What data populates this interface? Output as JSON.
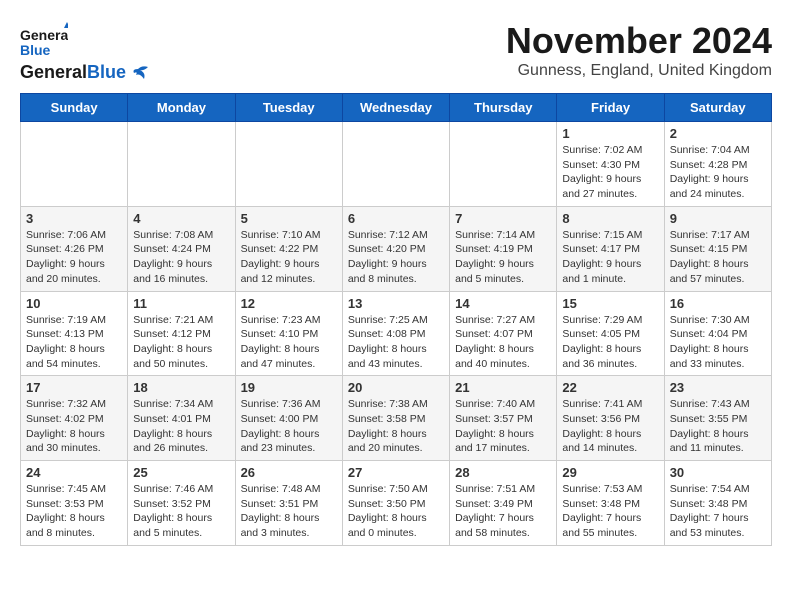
{
  "header": {
    "logo_general": "General",
    "logo_blue": "Blue",
    "month_year": "November 2024",
    "location": "Gunness, England, United Kingdom"
  },
  "days_of_week": [
    "Sunday",
    "Monday",
    "Tuesday",
    "Wednesday",
    "Thursday",
    "Friday",
    "Saturday"
  ],
  "weeks": [
    [
      {
        "day": "",
        "info": ""
      },
      {
        "day": "",
        "info": ""
      },
      {
        "day": "",
        "info": ""
      },
      {
        "day": "",
        "info": ""
      },
      {
        "day": "",
        "info": ""
      },
      {
        "day": "1",
        "info": "Sunrise: 7:02 AM\nSunset: 4:30 PM\nDaylight: 9 hours\nand 27 minutes."
      },
      {
        "day": "2",
        "info": "Sunrise: 7:04 AM\nSunset: 4:28 PM\nDaylight: 9 hours\nand 24 minutes."
      }
    ],
    [
      {
        "day": "3",
        "info": "Sunrise: 7:06 AM\nSunset: 4:26 PM\nDaylight: 9 hours\nand 20 minutes."
      },
      {
        "day": "4",
        "info": "Sunrise: 7:08 AM\nSunset: 4:24 PM\nDaylight: 9 hours\nand 16 minutes."
      },
      {
        "day": "5",
        "info": "Sunrise: 7:10 AM\nSunset: 4:22 PM\nDaylight: 9 hours\nand 12 minutes."
      },
      {
        "day": "6",
        "info": "Sunrise: 7:12 AM\nSunset: 4:20 PM\nDaylight: 9 hours\nand 8 minutes."
      },
      {
        "day": "7",
        "info": "Sunrise: 7:14 AM\nSunset: 4:19 PM\nDaylight: 9 hours\nand 5 minutes."
      },
      {
        "day": "8",
        "info": "Sunrise: 7:15 AM\nSunset: 4:17 PM\nDaylight: 9 hours\nand 1 minute."
      },
      {
        "day": "9",
        "info": "Sunrise: 7:17 AM\nSunset: 4:15 PM\nDaylight: 8 hours\nand 57 minutes."
      }
    ],
    [
      {
        "day": "10",
        "info": "Sunrise: 7:19 AM\nSunset: 4:13 PM\nDaylight: 8 hours\nand 54 minutes."
      },
      {
        "day": "11",
        "info": "Sunrise: 7:21 AM\nSunset: 4:12 PM\nDaylight: 8 hours\nand 50 minutes."
      },
      {
        "day": "12",
        "info": "Sunrise: 7:23 AM\nSunset: 4:10 PM\nDaylight: 8 hours\nand 47 minutes."
      },
      {
        "day": "13",
        "info": "Sunrise: 7:25 AM\nSunset: 4:08 PM\nDaylight: 8 hours\nand 43 minutes."
      },
      {
        "day": "14",
        "info": "Sunrise: 7:27 AM\nSunset: 4:07 PM\nDaylight: 8 hours\nand 40 minutes."
      },
      {
        "day": "15",
        "info": "Sunrise: 7:29 AM\nSunset: 4:05 PM\nDaylight: 8 hours\nand 36 minutes."
      },
      {
        "day": "16",
        "info": "Sunrise: 7:30 AM\nSunset: 4:04 PM\nDaylight: 8 hours\nand 33 minutes."
      }
    ],
    [
      {
        "day": "17",
        "info": "Sunrise: 7:32 AM\nSunset: 4:02 PM\nDaylight: 8 hours\nand 30 minutes."
      },
      {
        "day": "18",
        "info": "Sunrise: 7:34 AM\nSunset: 4:01 PM\nDaylight: 8 hours\nand 26 minutes."
      },
      {
        "day": "19",
        "info": "Sunrise: 7:36 AM\nSunset: 4:00 PM\nDaylight: 8 hours\nand 23 minutes."
      },
      {
        "day": "20",
        "info": "Sunrise: 7:38 AM\nSunset: 3:58 PM\nDaylight: 8 hours\nand 20 minutes."
      },
      {
        "day": "21",
        "info": "Sunrise: 7:40 AM\nSunset: 3:57 PM\nDaylight: 8 hours\nand 17 minutes."
      },
      {
        "day": "22",
        "info": "Sunrise: 7:41 AM\nSunset: 3:56 PM\nDaylight: 8 hours\nand 14 minutes."
      },
      {
        "day": "23",
        "info": "Sunrise: 7:43 AM\nSunset: 3:55 PM\nDaylight: 8 hours\nand 11 minutes."
      }
    ],
    [
      {
        "day": "24",
        "info": "Sunrise: 7:45 AM\nSunset: 3:53 PM\nDaylight: 8 hours\nand 8 minutes."
      },
      {
        "day": "25",
        "info": "Sunrise: 7:46 AM\nSunset: 3:52 PM\nDaylight: 8 hours\nand 5 minutes."
      },
      {
        "day": "26",
        "info": "Sunrise: 7:48 AM\nSunset: 3:51 PM\nDaylight: 8 hours\nand 3 minutes."
      },
      {
        "day": "27",
        "info": "Sunrise: 7:50 AM\nSunset: 3:50 PM\nDaylight: 8 hours\nand 0 minutes."
      },
      {
        "day": "28",
        "info": "Sunrise: 7:51 AM\nSunset: 3:49 PM\nDaylight: 7 hours\nand 58 minutes."
      },
      {
        "day": "29",
        "info": "Sunrise: 7:53 AM\nSunset: 3:48 PM\nDaylight: 7 hours\nand 55 minutes."
      },
      {
        "day": "30",
        "info": "Sunrise: 7:54 AM\nSunset: 3:48 PM\nDaylight: 7 hours\nand 53 minutes."
      }
    ]
  ]
}
